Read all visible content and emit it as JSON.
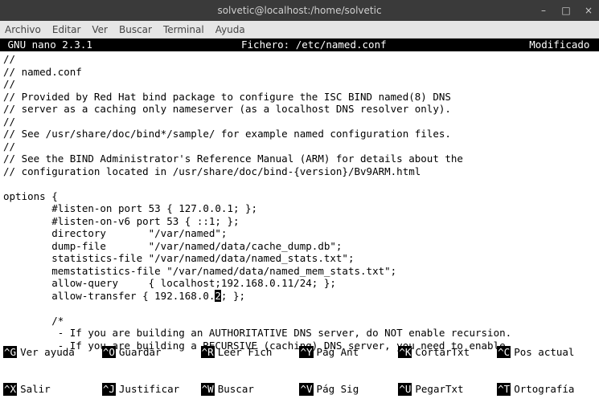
{
  "window": {
    "title": "solvetic@localhost:/home/solvetic",
    "min": "–",
    "max": "□",
    "close": "×"
  },
  "menubar": {
    "items": [
      "Archivo",
      "Editar",
      "Ver",
      "Buscar",
      "Terminal",
      "Ayuda"
    ]
  },
  "nano_header": {
    "version": " GNU nano 2.3.1 ",
    "file_label": "Fichero: /etc/named.conf",
    "status": "Modificado "
  },
  "editor_lines": [
    "//",
    "// named.conf",
    "//",
    "// Provided by Red Hat bind package to configure the ISC BIND named(8) DNS",
    "// server as a caching only nameserver (as a localhost DNS resolver only).",
    "//",
    "// See /usr/share/doc/bind*/sample/ for example named configuration files.",
    "//",
    "// See the BIND Administrator's Reference Manual (ARM) for details about the",
    "// configuration located in /usr/share/doc/bind-{version}/Bv9ARM.html",
    "",
    "options {",
    "        #listen-on port 53 { 127.0.0.1; };",
    "        #listen-on-v6 port 53 { ::1; };",
    "        directory       \"/var/named\";",
    "        dump-file       \"/var/named/data/cache_dump.db\";",
    "        statistics-file \"/var/named/data/named_stats.txt\";",
    "        memstatistics-file \"/var/named/data/named_mem_stats.txt\";",
    "        allow-query     { localhost;192.168.0.11/24; };",
    "        allow-transfer { 192.168.0.2; };",
    "",
    "        /*",
    "         - If you are building an AUTHORITATIVE DNS server, do NOT enable recursion.",
    "         - If you are building a RECURSIVE (caching) DNS server, you need to enable"
  ],
  "cursor_line_index": 19,
  "cursor_char_index": 35,
  "shortcuts": {
    "row1": [
      {
        "key": "^G",
        "label": "Ver ayuda"
      },
      {
        "key": "^O",
        "label": "Guardar"
      },
      {
        "key": "^R",
        "label": "Leer Fich"
      },
      {
        "key": "^Y",
        "label": "Pág Ant"
      },
      {
        "key": "^K",
        "label": "CortarTxt"
      },
      {
        "key": "^C",
        "label": "Pos actual"
      }
    ],
    "row2": [
      {
        "key": "^X",
        "label": "Salir"
      },
      {
        "key": "^J",
        "label": "Justificar"
      },
      {
        "key": "^W",
        "label": "Buscar"
      },
      {
        "key": "^V",
        "label": "Pág Sig"
      },
      {
        "key": "^U",
        "label": "PegarTxt"
      },
      {
        "key": "^T",
        "label": "Ortografía"
      }
    ]
  }
}
